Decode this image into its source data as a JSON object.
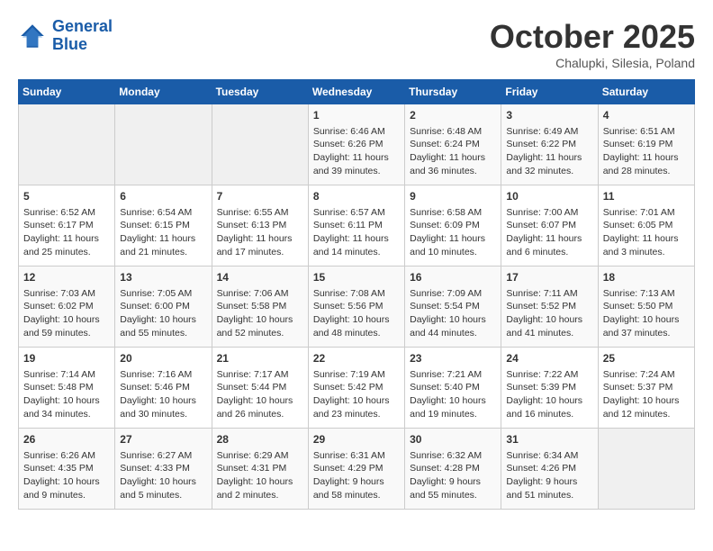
{
  "header": {
    "logo_line1": "General",
    "logo_line2": "Blue",
    "month": "October 2025",
    "location": "Chalupki, Silesia, Poland"
  },
  "days_of_week": [
    "Sunday",
    "Monday",
    "Tuesday",
    "Wednesday",
    "Thursday",
    "Friday",
    "Saturday"
  ],
  "weeks": [
    [
      {
        "day": "",
        "info": ""
      },
      {
        "day": "",
        "info": ""
      },
      {
        "day": "",
        "info": ""
      },
      {
        "day": "1",
        "info": "Sunrise: 6:46 AM\nSunset: 6:26 PM\nDaylight: 11 hours\nand 39 minutes."
      },
      {
        "day": "2",
        "info": "Sunrise: 6:48 AM\nSunset: 6:24 PM\nDaylight: 11 hours\nand 36 minutes."
      },
      {
        "day": "3",
        "info": "Sunrise: 6:49 AM\nSunset: 6:22 PM\nDaylight: 11 hours\nand 32 minutes."
      },
      {
        "day": "4",
        "info": "Sunrise: 6:51 AM\nSunset: 6:19 PM\nDaylight: 11 hours\nand 28 minutes."
      }
    ],
    [
      {
        "day": "5",
        "info": "Sunrise: 6:52 AM\nSunset: 6:17 PM\nDaylight: 11 hours\nand 25 minutes."
      },
      {
        "day": "6",
        "info": "Sunrise: 6:54 AM\nSunset: 6:15 PM\nDaylight: 11 hours\nand 21 minutes."
      },
      {
        "day": "7",
        "info": "Sunrise: 6:55 AM\nSunset: 6:13 PM\nDaylight: 11 hours\nand 17 minutes."
      },
      {
        "day": "8",
        "info": "Sunrise: 6:57 AM\nSunset: 6:11 PM\nDaylight: 11 hours\nand 14 minutes."
      },
      {
        "day": "9",
        "info": "Sunrise: 6:58 AM\nSunset: 6:09 PM\nDaylight: 11 hours\nand 10 minutes."
      },
      {
        "day": "10",
        "info": "Sunrise: 7:00 AM\nSunset: 6:07 PM\nDaylight: 11 hours\nand 6 minutes."
      },
      {
        "day": "11",
        "info": "Sunrise: 7:01 AM\nSunset: 6:05 PM\nDaylight: 11 hours\nand 3 minutes."
      }
    ],
    [
      {
        "day": "12",
        "info": "Sunrise: 7:03 AM\nSunset: 6:02 PM\nDaylight: 10 hours\nand 59 minutes."
      },
      {
        "day": "13",
        "info": "Sunrise: 7:05 AM\nSunset: 6:00 PM\nDaylight: 10 hours\nand 55 minutes."
      },
      {
        "day": "14",
        "info": "Sunrise: 7:06 AM\nSunset: 5:58 PM\nDaylight: 10 hours\nand 52 minutes."
      },
      {
        "day": "15",
        "info": "Sunrise: 7:08 AM\nSunset: 5:56 PM\nDaylight: 10 hours\nand 48 minutes."
      },
      {
        "day": "16",
        "info": "Sunrise: 7:09 AM\nSunset: 5:54 PM\nDaylight: 10 hours\nand 44 minutes."
      },
      {
        "day": "17",
        "info": "Sunrise: 7:11 AM\nSunset: 5:52 PM\nDaylight: 10 hours\nand 41 minutes."
      },
      {
        "day": "18",
        "info": "Sunrise: 7:13 AM\nSunset: 5:50 PM\nDaylight: 10 hours\nand 37 minutes."
      }
    ],
    [
      {
        "day": "19",
        "info": "Sunrise: 7:14 AM\nSunset: 5:48 PM\nDaylight: 10 hours\nand 34 minutes."
      },
      {
        "day": "20",
        "info": "Sunrise: 7:16 AM\nSunset: 5:46 PM\nDaylight: 10 hours\nand 30 minutes."
      },
      {
        "day": "21",
        "info": "Sunrise: 7:17 AM\nSunset: 5:44 PM\nDaylight: 10 hours\nand 26 minutes."
      },
      {
        "day": "22",
        "info": "Sunrise: 7:19 AM\nSunset: 5:42 PM\nDaylight: 10 hours\nand 23 minutes."
      },
      {
        "day": "23",
        "info": "Sunrise: 7:21 AM\nSunset: 5:40 PM\nDaylight: 10 hours\nand 19 minutes."
      },
      {
        "day": "24",
        "info": "Sunrise: 7:22 AM\nSunset: 5:39 PM\nDaylight: 10 hours\nand 16 minutes."
      },
      {
        "day": "25",
        "info": "Sunrise: 7:24 AM\nSunset: 5:37 PM\nDaylight: 10 hours\nand 12 minutes."
      }
    ],
    [
      {
        "day": "26",
        "info": "Sunrise: 6:26 AM\nSunset: 4:35 PM\nDaylight: 10 hours\nand 9 minutes."
      },
      {
        "day": "27",
        "info": "Sunrise: 6:27 AM\nSunset: 4:33 PM\nDaylight: 10 hours\nand 5 minutes."
      },
      {
        "day": "28",
        "info": "Sunrise: 6:29 AM\nSunset: 4:31 PM\nDaylight: 10 hours\nand 2 minutes."
      },
      {
        "day": "29",
        "info": "Sunrise: 6:31 AM\nSunset: 4:29 PM\nDaylight: 9 hours\nand 58 minutes."
      },
      {
        "day": "30",
        "info": "Sunrise: 6:32 AM\nSunset: 4:28 PM\nDaylight: 9 hours\nand 55 minutes."
      },
      {
        "day": "31",
        "info": "Sunrise: 6:34 AM\nSunset: 4:26 PM\nDaylight: 9 hours\nand 51 minutes."
      },
      {
        "day": "",
        "info": ""
      }
    ]
  ]
}
